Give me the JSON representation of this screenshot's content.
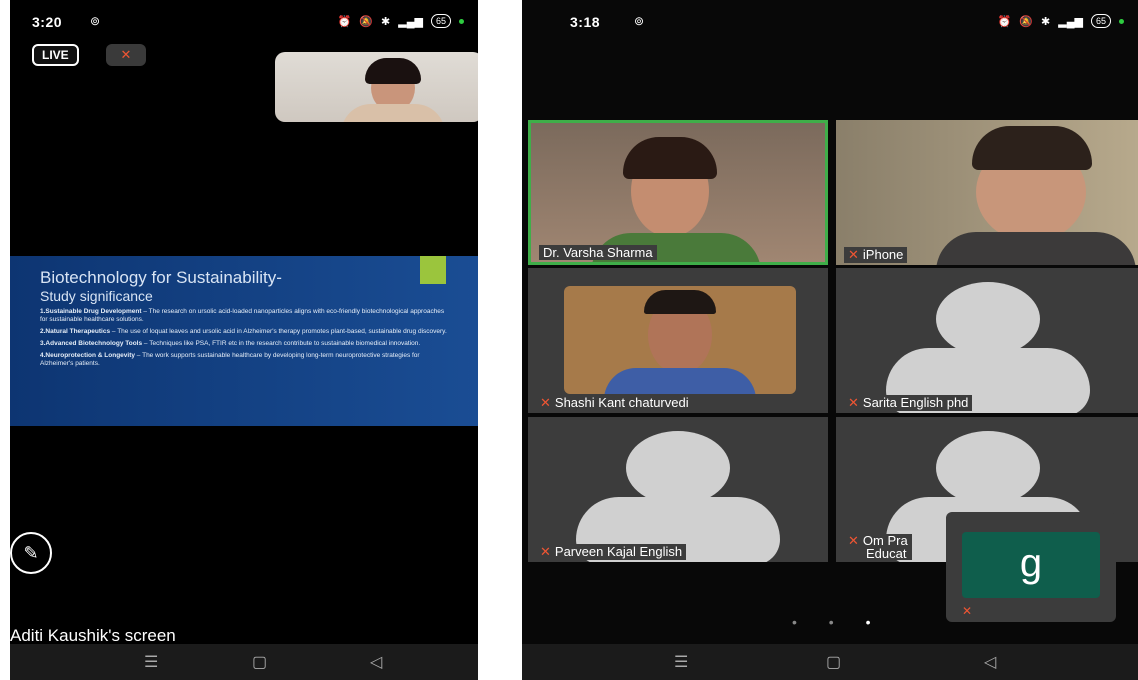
{
  "left_screen": {
    "status": {
      "time": "3:20",
      "battery": "65"
    },
    "live_badge": "LIVE",
    "slide": {
      "title": "Biotechnology for Sustainability-",
      "subtitle": "Study significance",
      "points": [
        {
          "heading": "1.Sustainable Drug Development",
          "text": "– The research on ursolic acid-loaded nanoparticles aligns with eco-friendly biotechnological approaches for sustainable healthcare solutions."
        },
        {
          "heading": "2.Natural Therapeutics",
          "text": "– The use of loquat leaves and ursolic acid in Alzheimer's therapy promotes plant-based, sustainable drug discovery."
        },
        {
          "heading": "3.Advanced Biotechnology Tools",
          "text": "– Techniques like PSA, FTIR etc in the research contribute to sustainable biomedical innovation."
        },
        {
          "heading": "4.Neuroprotection & Longevity",
          "text": "– The work supports sustainable healthcare by developing long-term neuroprotective strategies for Alzheimer's patients."
        }
      ]
    },
    "screen_label": "Aditi Kaushik's screen"
  },
  "right_screen": {
    "status": {
      "time": "3:18",
      "battery": "65"
    },
    "participants": [
      {
        "name": "Dr. Varsha Sharma"
      },
      {
        "name": "iPhone"
      },
      {
        "name": "Shashi Kant chaturvedi"
      },
      {
        "name": "Sarita English phd"
      },
      {
        "name": "Parveen Kajal English"
      },
      {
        "name": "Om Pra"
      },
      {
        "name": "Educat"
      }
    ],
    "floating_tile_letter": "g"
  },
  "colors": {
    "active_speaker_border": "#3fae49",
    "mic_off": "#e53935",
    "slide_bg": "#12407f",
    "slide_accent": "#9bc53d"
  }
}
